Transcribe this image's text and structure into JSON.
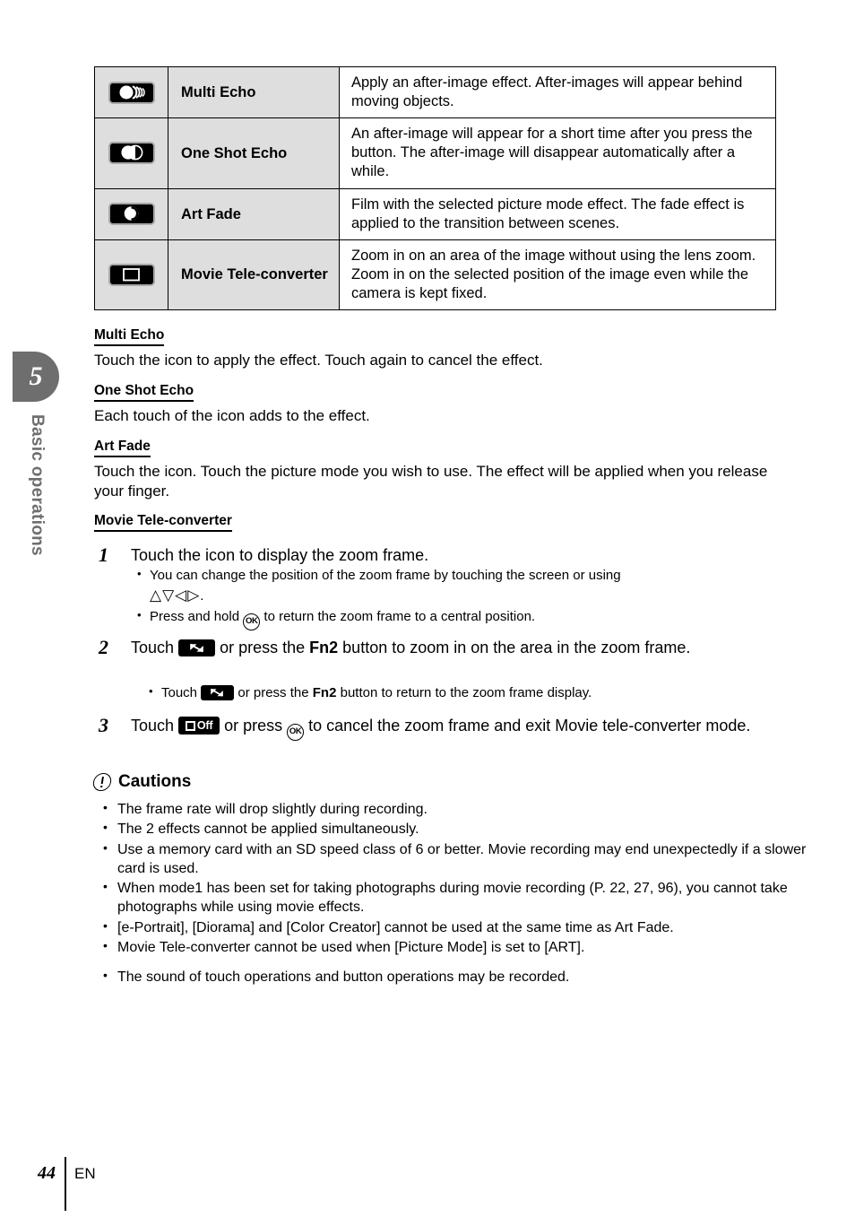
{
  "chapter": {
    "number": "5",
    "title": "Basic operations"
  },
  "table": {
    "rows": [
      {
        "icon": "multi-echo-icon",
        "name": "Multi Echo",
        "description": "Apply an after-image effect. After-images will appear behind moving objects."
      },
      {
        "icon": "one-shot-echo-icon",
        "name": "One Shot Echo",
        "description": "An after-image will appear for a short time after you press the button. The after-image will disappear automatically after a while."
      },
      {
        "icon": "art-fade-icon",
        "name": "Art Fade",
        "description": "Film with the selected picture mode effect. The fade effect is applied to the transition between scenes."
      },
      {
        "icon": "movie-tele-converter-icon",
        "name": "Movie Tele-converter",
        "description": "Zoom in on an area of the image without using the lens zoom. Zoom in on the selected position of the image even while the camera is kept fixed."
      }
    ]
  },
  "sections": [
    {
      "heading": "Multi Echo",
      "body": "Touch the icon to apply the effect. Touch again to cancel the effect."
    },
    {
      "heading": "One Shot Echo",
      "body": "Each touch of the icon adds to the effect."
    },
    {
      "heading": "Art Fade",
      "body": "Touch the icon. Touch the picture mode you wish to use. The effect will be applied when you release your finger."
    },
    {
      "heading": "Movie Tele-converter",
      "body": ""
    }
  ],
  "steps": {
    "step1": {
      "number": "1",
      "text": "Touch the icon to display the zoom frame.",
      "bullet1_pre": "You can change the position of the zoom frame by touching the screen or using",
      "bullet1_arrows": "△▽◁▷",
      "bullet1_post": ".",
      "bullet2_pre": "Press and hold",
      "bullet2_ok": "OK",
      "bullet2_post": "to return the zoom frame to a central position."
    },
    "step2": {
      "number": "2",
      "text_pre": "Touch",
      "icon": "zoom-in-icon",
      "text_mid": "or press the",
      "fn_label": "Fn2",
      "text_post": "button to zoom in on the area in the zoom frame.",
      "bullet_pre": "Touch",
      "bullet_icon": "zoom-out-icon",
      "bullet_mid": "or press the",
      "bullet_fn": "Fn2",
      "bullet_post": "button to return to the zoom frame display."
    },
    "step3": {
      "number": "3",
      "text_pre": "Touch",
      "icon_label": "Off",
      "text_mid": "or press",
      "ok_label": "OK",
      "text_post": "to cancel the zoom frame and exit Movie tele-converter mode."
    }
  },
  "cautions": {
    "heading": "Cautions",
    "items": [
      "The frame rate will drop slightly during recording.",
      "The 2 effects cannot be applied simultaneously.",
      "Use a memory card with an SD speed class of 6 or better. Movie recording may end unexpectedly if a slower card is used.",
      "When mode1 has been set for taking photographs during movie recording (P. 22, 27, 96), you cannot take photographs while using movie effects.",
      "[e-Portrait], [Diorama] and [Color Creator] cannot be used at the same time as Art Fade.",
      "Movie Tele-converter cannot be used when [Picture Mode] is set to [ART].",
      "The sound of touch operations and button operations may be recorded."
    ]
  },
  "footer": {
    "page_number": "44",
    "language": "EN"
  },
  "colors": {
    "chapter_tab": "#6e6e6e",
    "table_label_bg": "#dededf",
    "text": "#000000"
  }
}
